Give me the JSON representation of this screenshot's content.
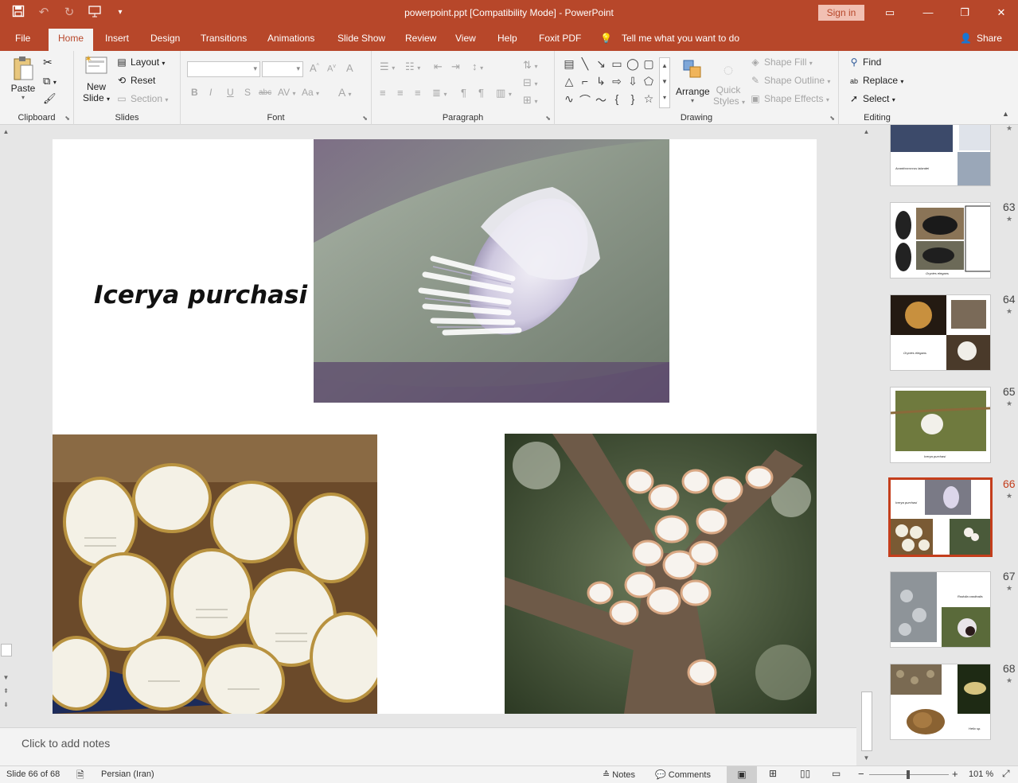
{
  "window": {
    "title": "powerpoint.ppt [Compatibility Mode]  -  PowerPoint",
    "sign_in": "Sign in"
  },
  "tabs": [
    "File",
    "Home",
    "Insert",
    "Design",
    "Transitions",
    "Animations",
    "Slide Show",
    "Review",
    "View",
    "Help",
    "Foxit PDF"
  ],
  "tell_me": "Tell me what you want to do",
  "share": "Share",
  "ribbon": {
    "clipboard": {
      "label": "Clipboard",
      "paste": "Paste"
    },
    "slides": {
      "label": "Slides",
      "new_slide_1": "New",
      "new_slide_2": "Slide",
      "layout": "Layout",
      "reset": "Reset",
      "section": "Section"
    },
    "font": {
      "label": "Font"
    },
    "paragraph": {
      "label": "Paragraph"
    },
    "drawing": {
      "label": "Drawing",
      "arrange": "Arrange",
      "quick_styles_1": "Quick",
      "quick_styles_2": "Styles",
      "shape_fill": "Shape Fill",
      "shape_outline": "Shape Outline",
      "shape_effects": "Shape Effects"
    },
    "editing": {
      "label": "Editing",
      "find": "Find",
      "replace": "Replace",
      "select": "Select"
    }
  },
  "slide": {
    "title": "Icerya purchasi"
  },
  "notes_placeholder": "Click to add notes",
  "thumbnails": [
    {
      "num": "",
      "caption": "Acanthococcus lalandei"
    },
    {
      "num": "63",
      "caption": "Oryctes elegans"
    },
    {
      "num": "64",
      "caption": "Oryctes elegans"
    },
    {
      "num": "65",
      "caption": "Icerya purchasi"
    },
    {
      "num": "66",
      "caption": "Icerya purchasi"
    },
    {
      "num": "67",
      "caption": "Rodolia cardinalis"
    },
    {
      "num": "68",
      "caption": "Helix sp."
    }
  ],
  "status": {
    "slide_info": "Slide 66 of 68",
    "language": "Persian (Iran)",
    "notes": "Notes",
    "comments": "Comments",
    "zoom": "101 %"
  },
  "colors": {
    "accent": "#b7472a",
    "selected_thumb": "#c43e1c"
  }
}
